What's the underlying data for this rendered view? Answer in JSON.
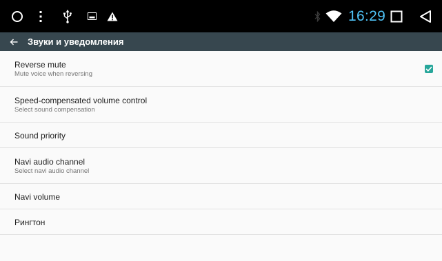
{
  "status_bar": {
    "time": "16:29",
    "icons": [
      "home-circle-icon",
      "more-vert-icon",
      "usb-icon",
      "image-icon",
      "warning-icon",
      "bluetooth-icon",
      "wifi-icon",
      "recents-square-icon",
      "back-triangle-icon"
    ],
    "time_color": "#4fc3f7"
  },
  "toolbar": {
    "title": "Звуки и уведомления",
    "background": "#37474f"
  },
  "settings": [
    {
      "title": "Reverse mute",
      "summary": "Mute voice when reversing",
      "checked": true
    },
    {
      "title": "Speed-compensated volume control",
      "summary": "Select sound compensation"
    },
    {
      "title": "Sound priority"
    },
    {
      "title": "Navi audio channel",
      "summary": "Select navi audio channel"
    },
    {
      "title": "Navi volume"
    },
    {
      "title": "Рингтон"
    }
  ],
  "colors": {
    "accent": "#26a69a",
    "background": "#fafafa"
  }
}
